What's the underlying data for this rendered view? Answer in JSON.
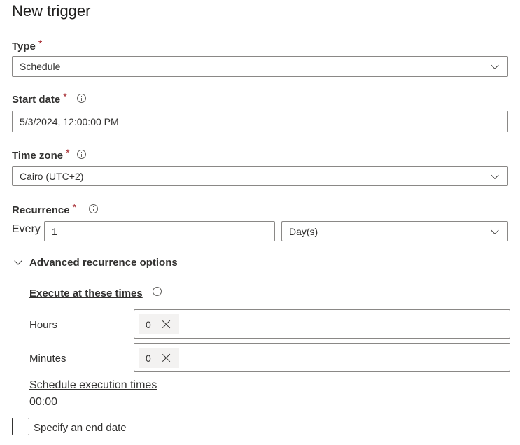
{
  "title": "New trigger",
  "required_marker": "*",
  "type": {
    "label": "Type",
    "value": "Schedule"
  },
  "start_date": {
    "label": "Start date",
    "value": "5/3/2024, 12:00:00 PM"
  },
  "time_zone": {
    "label": "Time zone",
    "value": "Cairo (UTC+2)"
  },
  "recurrence": {
    "label": "Recurrence",
    "every_label": "Every",
    "interval": "1",
    "unit": "Day(s)"
  },
  "advanced": {
    "toggle_label": "Advanced recurrence options",
    "execute_label": "Execute at these times",
    "hours": {
      "label": "Hours",
      "chips": [
        "0"
      ]
    },
    "minutes": {
      "label": "Minutes",
      "chips": [
        "0"
      ]
    },
    "schedule_link": "Schedule execution times",
    "schedule_value": "00:00"
  },
  "end_date": {
    "label": "Specify an end date",
    "checked": false
  }
}
